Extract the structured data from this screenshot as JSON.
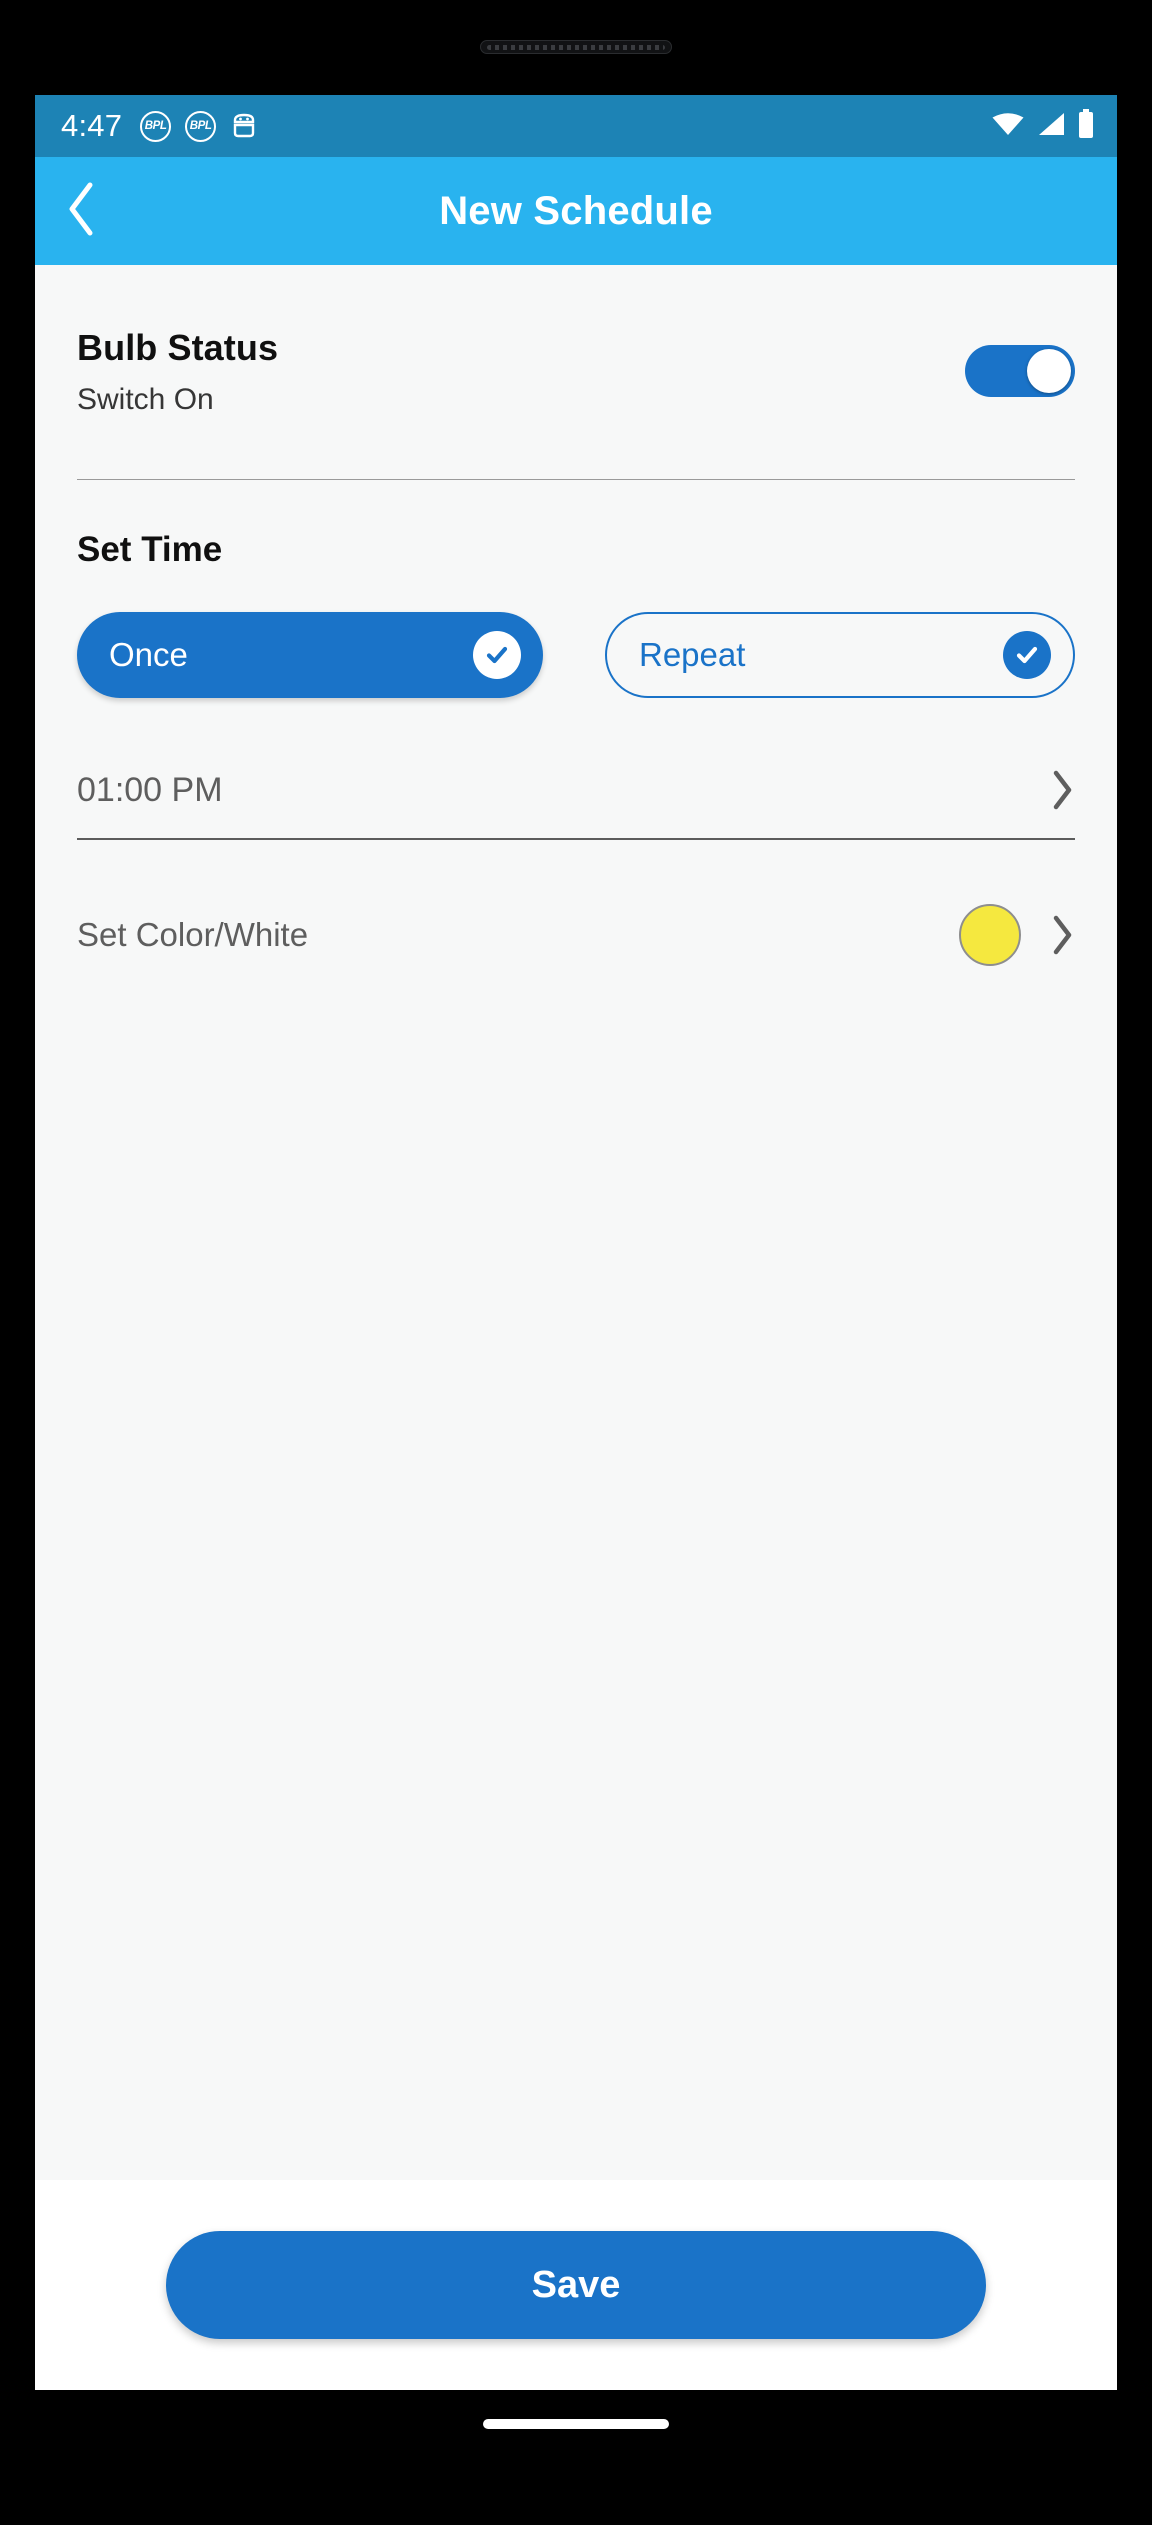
{
  "status_bar": {
    "clock": "4:47",
    "background_color": "#1d83b5",
    "notification_icons": [
      {
        "name": "bpl-app-icon-1",
        "label": "BPL"
      },
      {
        "name": "bpl-app-icon-2",
        "label": "BPL"
      },
      {
        "name": "android-system-icon",
        "label": ""
      }
    ],
    "right_icons": [
      "wifi-icon",
      "cellular-signal-icon",
      "battery-icon"
    ]
  },
  "app_bar": {
    "title": "New Schedule",
    "back_icon": "chevron-left-icon",
    "background_color": "#29b3ef"
  },
  "bulb_status": {
    "title": "Bulb Status",
    "subtitle": "Switch On",
    "toggle_on": true,
    "toggle_color": "#1a73c8"
  },
  "set_time": {
    "title": "Set Time",
    "modes": [
      {
        "label": "Once",
        "selected": true,
        "style": "filled"
      },
      {
        "label": "Repeat",
        "selected": true,
        "style": "outlined"
      }
    ],
    "time_value": "01:00 PM",
    "time_chevron": "chevron-right-icon"
  },
  "set_color": {
    "label": "Set Color/White",
    "swatch_color": "#f5e83f",
    "chevron": "chevron-right-icon"
  },
  "footer": {
    "save_label": "Save",
    "save_color": "#1a73c8"
  }
}
